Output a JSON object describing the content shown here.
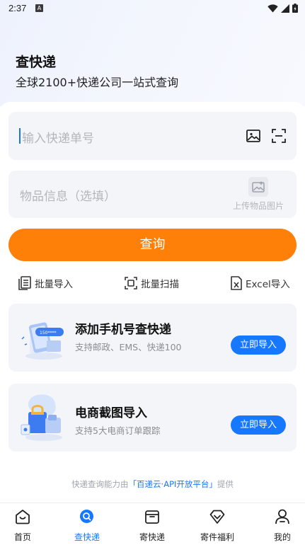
{
  "status_bar": {
    "time": "2:37",
    "notification_glyph": "A"
  },
  "hero": {
    "title": "查快递",
    "subtitle": "全球2100+快递公司一站式查询"
  },
  "tracking_input": {
    "placeholder": "输入快递单号",
    "icons": [
      "image-icon",
      "scan-icon"
    ]
  },
  "goods_input": {
    "placeholder": "物品信息（选填）",
    "upload_label": "上传物品图片"
  },
  "query_button": {
    "label": "查询",
    "color": "#ff8008"
  },
  "actions": [
    {
      "label": "批量导入",
      "icon": "document-list-icon"
    },
    {
      "label": "批量扫描",
      "icon": "scan-frame-icon"
    },
    {
      "label": "Excel导入",
      "icon": "excel-file-icon"
    }
  ],
  "cards": [
    {
      "title": "添加手机号查快递",
      "description": "支持邮政、EMS、快递100",
      "button": "立即导入",
      "icon": "phone-package-illustration"
    },
    {
      "title": "电商截图导入",
      "description": "支持5大电商订单跟踪",
      "button": "立即导入",
      "icon": "shopping-bag-illustration"
    }
  ],
  "footer": {
    "prefix": "快递查询能力由",
    "link": "「百递云·API开放平台」",
    "suffix": "提供"
  },
  "tabs": [
    {
      "label": "首页",
      "icon": "home-icon",
      "active": false
    },
    {
      "label": "查快递",
      "icon": "search-icon",
      "active": true
    },
    {
      "label": "寄快递",
      "icon": "box-icon",
      "active": false
    },
    {
      "label": "寄件福利",
      "icon": "diamond-icon",
      "active": false
    },
    {
      "label": "我的",
      "icon": "user-icon",
      "active": false
    }
  ],
  "colors": {
    "accent": "#1677ff",
    "primary_button": "#ff8008"
  }
}
